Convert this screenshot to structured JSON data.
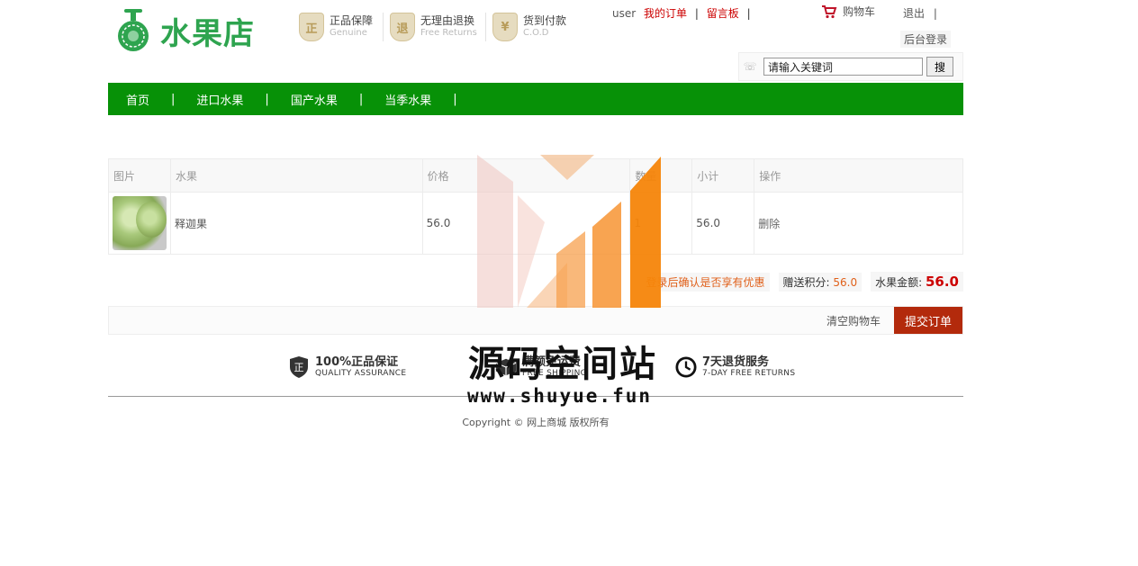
{
  "header": {
    "logo_text": "水果店",
    "promises": [
      {
        "icon": "genuine-badge-icon",
        "glyph": "正",
        "cn": "正品保障",
        "en": "Genuine"
      },
      {
        "icon": "returns-badge-icon",
        "glyph": "退",
        "cn": "无理由退换",
        "en": "Free Returns"
      },
      {
        "icon": "cod-badge-icon",
        "glyph": "¥",
        "cn": "货到付款",
        "en": "C.O.D"
      }
    ],
    "user": {
      "username": "user",
      "my_orders": "我的订单",
      "sep": "|",
      "message_board": "留言板"
    },
    "cart": "购物车",
    "logout": "退出",
    "admin_login": "后台登录",
    "search": {
      "value": "请输入关键词",
      "button": "搜"
    }
  },
  "nav": {
    "items": [
      "首页",
      "进口水果",
      "国产水果",
      "当季水果"
    ],
    "sep": "|"
  },
  "cart_table": {
    "headers": [
      "图片",
      "水果",
      "价格",
      "数量",
      "小计",
      "操作"
    ],
    "rows": [
      {
        "image": "custard-apple-image",
        "name": "释迦果",
        "price": "56.0",
        "quantity": "1",
        "subtotal": "56.0",
        "action": "删除"
      }
    ]
  },
  "summary": {
    "login_hint": "登录后确认是否享有优惠",
    "points_label": "赠送积分:",
    "points_value": "56.0",
    "total_label": "水果金额:",
    "total_value": "56.0"
  },
  "actions": {
    "clear": "清空购物车",
    "submit": "提交订单"
  },
  "services": [
    {
      "icon": "shield-icon",
      "title": "100%正品保证",
      "subtitle": "QUALITY ASSURANCE"
    },
    {
      "icon": "truck-icon",
      "title": "满额免运费",
      "subtitle": "FREE SHIPPING"
    },
    {
      "icon": "clock-icon",
      "title": "7天退货服务",
      "subtitle": "7-DAY FREE RETURNS"
    }
  ],
  "footer": {
    "copyright": "Copyright © 网上商城 版权所有"
  },
  "watermark": {
    "text": "源码空间站",
    "url": "www.shuyue.fun"
  },
  "colors": {
    "nav_green": "#079107",
    "logo_green": "#2ea44f",
    "submit_red": "#b32a0c",
    "highlight_red": "#cc0000",
    "orange": "#e0601a"
  }
}
